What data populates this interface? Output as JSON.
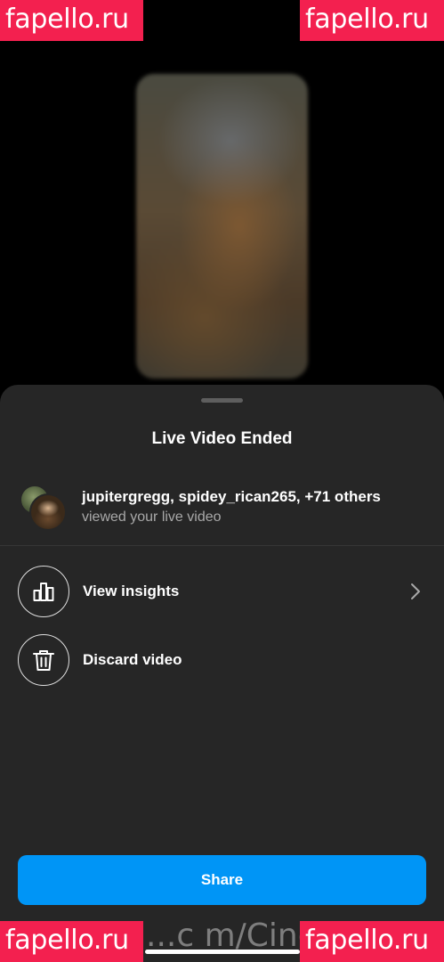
{
  "watermark": {
    "text": "fapello.ru",
    "bottom_overlay_text": "...c m/Cinc"
  },
  "sheet": {
    "title": "Live Video Ended",
    "viewers": {
      "names": "jupitergregg, spidey_rican265, +71 others",
      "subtitle": "viewed your live video"
    },
    "actions": [
      {
        "label": "View insights",
        "icon": "bar-chart-icon",
        "has_chevron": true
      },
      {
        "label": "Discard video",
        "icon": "trash-icon",
        "has_chevron": false
      }
    ],
    "share_button": "Share"
  },
  "colors": {
    "sheet_bg": "#262626",
    "accent": "#0095f6",
    "watermark_bg": "#f3204f",
    "secondary_text": "#a8a8a8"
  }
}
